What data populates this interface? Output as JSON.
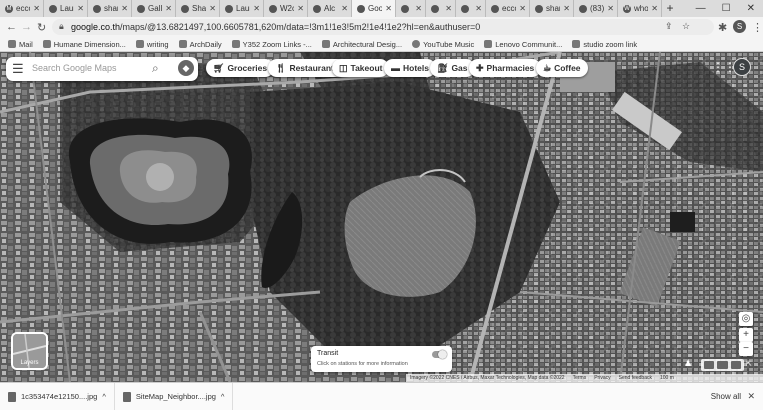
{
  "tabs": [
    {
      "title": "ecco",
      "icon": "gmail-icon",
      "active": false
    },
    {
      "title": "Laun",
      "icon": "document-icon",
      "active": false
    },
    {
      "title": "shari",
      "icon": "globe-icon",
      "active": false
    },
    {
      "title": "Gallo",
      "icon": "globe-icon",
      "active": false
    },
    {
      "title": "Sha",
      "icon": "bookmark-icon",
      "active": false
    },
    {
      "title": "Laun",
      "icon": "document-icon",
      "active": false
    },
    {
      "title": "W2c",
      "icon": "document-icon",
      "active": false
    },
    {
      "title": "Alc",
      "icon": "globe-icon",
      "active": false
    },
    {
      "title": "Goo",
      "icon": "maps-icon",
      "active": true
    },
    {
      "title": "",
      "icon": "image-icon",
      "active": false
    },
    {
      "title": "",
      "icon": "globe-icon",
      "active": false
    },
    {
      "title": "",
      "icon": "globe-icon",
      "active": false
    },
    {
      "title": "ecco",
      "icon": "youtube-icon",
      "active": false
    },
    {
      "title": "shar",
      "icon": "globe-icon",
      "active": false
    },
    {
      "title": "(83)",
      "icon": "pinterest-icon",
      "active": false
    },
    {
      "title": "who",
      "icon": "wikipedia-icon",
      "active": false
    }
  ],
  "new_tab_label": "+",
  "window_controls": {
    "minimize": "—",
    "maximize": "☐",
    "close": "✕"
  },
  "address": {
    "domain": "google.co.th",
    "path": "/maps/@13.6821497,100.6605781,620m/data=!3m1!1e3!5m2!1e4!1e2?hl=en&authuser=0"
  },
  "bookmarks": [
    {
      "label": "Mail",
      "icon": "gmail-icon"
    },
    {
      "label": "Humane Dimension...",
      "icon": "bookmark-icon"
    },
    {
      "label": "writing",
      "icon": "folder-icon"
    },
    {
      "label": "ArchDaily",
      "icon": "globe-icon"
    },
    {
      "label": "Y352 Zoom Links -...",
      "icon": "document-icon"
    },
    {
      "label": "Architectural Desig...",
      "icon": "globe-icon"
    },
    {
      "label": "YouTube Music",
      "icon": "youtube-music-icon"
    },
    {
      "label": "Lenovo Communit...",
      "icon": "globe-icon"
    },
    {
      "label": "studio zoom link",
      "icon": "globe-icon"
    }
  ],
  "search": {
    "placeholder": "Search Google Maps"
  },
  "chips": [
    {
      "label": "Groceries",
      "icon": "cart-icon"
    },
    {
      "label": "Restaurants",
      "icon": "fork-knife-icon"
    },
    {
      "label": "Takeout",
      "icon": "takeout-icon"
    },
    {
      "label": "Hotels",
      "icon": "bed-icon"
    },
    {
      "label": "Gas",
      "icon": "gas-pump-icon"
    },
    {
      "label": "Pharmacies",
      "icon": "pharmacy-icon"
    },
    {
      "label": "Coffee",
      "icon": "coffee-icon"
    }
  ],
  "account": {
    "initial": "S"
  },
  "layers": {
    "label": "Layers"
  },
  "transit": {
    "title": "Transit",
    "subtitle": "Click on stations for more information"
  },
  "map_controls": {
    "zoom_in": "+",
    "zoom_out": "−"
  },
  "attribution": {
    "imagery": "Imagery ©2022 CNES / Airbus, Maxar Technologies, Map data ©2022",
    "terms": "Terms",
    "privacy": "Privacy",
    "feedback": "Send feedback",
    "scale": "100 m"
  },
  "downloads": [
    {
      "name": "1c353474e12150....jpg"
    },
    {
      "name": "SiteMap_Neighbor....jpg"
    }
  ],
  "show_all": "Show all"
}
